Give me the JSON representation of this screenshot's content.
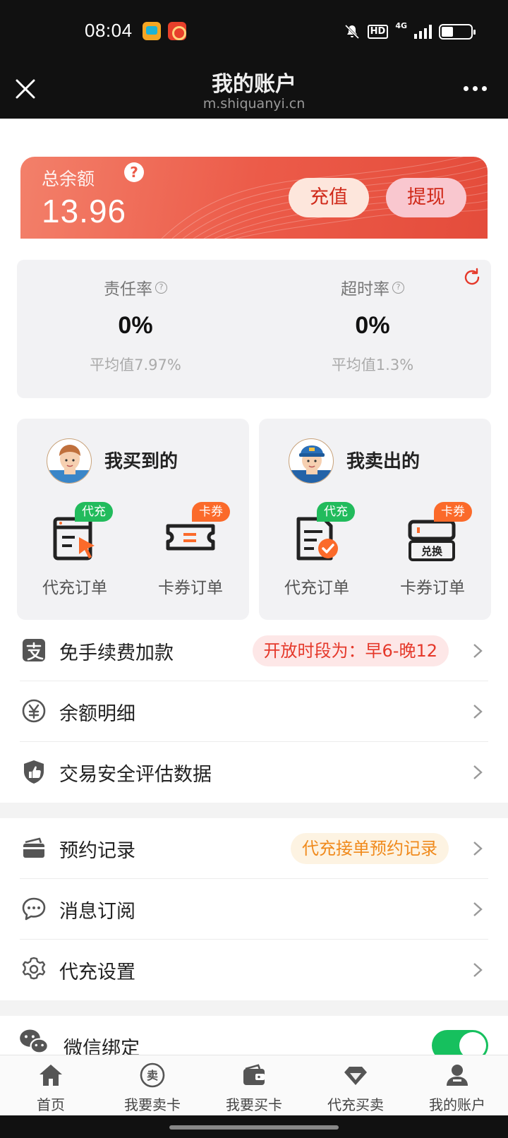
{
  "status_bar": {
    "time": "08:04",
    "network_label": "HD",
    "network_type": "4G"
  },
  "nav": {
    "title": "我的账户",
    "url": "m.shiquanyi.cn"
  },
  "balance": {
    "label": "总余额",
    "help": "?",
    "value": "13.96",
    "charge_label": "充值",
    "withdraw_label": "提现"
  },
  "rates": [
    {
      "name": "责任率",
      "value": "0%",
      "average": "平均值7.97%"
    },
    {
      "name": "超时率",
      "value": "0%",
      "average": "平均值1.3%"
    }
  ],
  "trade_cards": {
    "buy": {
      "title": "我买到的",
      "orders": [
        {
          "label": "代充订单",
          "tag": "代充"
        },
        {
          "label": "卡券订单",
          "tag": "卡券"
        }
      ]
    },
    "sell": {
      "title": "我卖出的",
      "orders": [
        {
          "label": "代充订单",
          "tag": "代充"
        },
        {
          "label": "卡券订单",
          "tag": "卡券",
          "badge_text": "兑换"
        }
      ]
    }
  },
  "menu_group_1": [
    {
      "label": "免手续费加款",
      "pill": "开放时段为：早6-晚12",
      "icon": "alipay-icon"
    },
    {
      "label": "余额明细",
      "icon": "yuan-icon"
    },
    {
      "label": "交易安全评估数据",
      "icon": "shield-thumb-icon"
    }
  ],
  "menu_group_2": [
    {
      "label": "预约记录",
      "pill": "代充接单预约记录",
      "icon": "wallet-card-icon"
    },
    {
      "label": "消息订阅",
      "icon": "chat-icon"
    },
    {
      "label": "代充设置",
      "icon": "gear-icon"
    }
  ],
  "menu_group_3": [
    {
      "label": "微信绑定",
      "icon": "wechat-icon",
      "switch_on": true
    }
  ],
  "tabs": [
    {
      "label": "首页",
      "icon": "home-icon"
    },
    {
      "label": "我要卖卡",
      "icon": "sell-icon",
      "glyph": "卖"
    },
    {
      "label": "我要买卡",
      "icon": "wallet-icon"
    },
    {
      "label": "代充买卖",
      "icon": "diamond-icon"
    },
    {
      "label": "我的账户",
      "icon": "user-icon"
    }
  ],
  "colors": {
    "accent_red": "#ec5b49",
    "switch_green": "#16c05e",
    "tag_green": "#22bb5c",
    "tag_orange": "#fb6a2a"
  }
}
